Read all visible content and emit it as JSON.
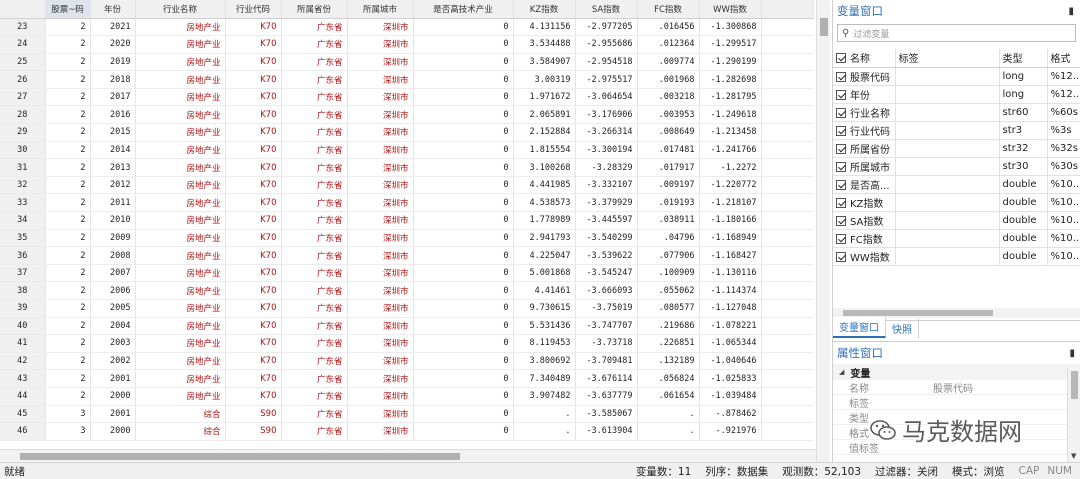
{
  "grid": {
    "columns": [
      "股票~码",
      "年份",
      "行业名称",
      "行业代码",
      "所属省份",
      "所属城市",
      "是否高技术产业",
      "KZ指数",
      "SA指数",
      "FC指数",
      "WW指数"
    ],
    "rows": [
      [
        "23",
        "2",
        "2021",
        "房地产业",
        "K70",
        "广东省",
        "深圳市",
        "0",
        "4.131156",
        "-2.977205",
        ".016456",
        "-1.300868"
      ],
      [
        "24",
        "2",
        "2020",
        "房地产业",
        "K70",
        "广东省",
        "深圳市",
        "0",
        "3.534488",
        "-2.955686",
        ".012364",
        "-1.299517"
      ],
      [
        "25",
        "2",
        "2019",
        "房地产业",
        "K70",
        "广东省",
        "深圳市",
        "0",
        "3.584907",
        "-2.954518",
        ".009774",
        "-1.290199"
      ],
      [
        "26",
        "2",
        "2018",
        "房地产业",
        "K70",
        "广东省",
        "深圳市",
        "0",
        "3.00319",
        "-2.975517",
        ".001968",
        "-1.282698"
      ],
      [
        "27",
        "2",
        "2017",
        "房地产业",
        "K70",
        "广东省",
        "深圳市",
        "0",
        "1.971672",
        "-3.064654",
        ".003218",
        "-1.281795"
      ],
      [
        "28",
        "2",
        "2016",
        "房地产业",
        "K70",
        "广东省",
        "深圳市",
        "0",
        "2.065891",
        "-3.176906",
        ".003953",
        "-1.249618"
      ],
      [
        "29",
        "2",
        "2015",
        "房地产业",
        "K70",
        "广东省",
        "深圳市",
        "0",
        "2.152884",
        "-3.266314",
        ".008649",
        "-1.213458"
      ],
      [
        "30",
        "2",
        "2014",
        "房地产业",
        "K70",
        "广东省",
        "深圳市",
        "0",
        "1.815554",
        "-3.300194",
        ".017481",
        "-1.241766"
      ],
      [
        "31",
        "2",
        "2013",
        "房地产业",
        "K70",
        "广东省",
        "深圳市",
        "0",
        "3.100268",
        "-3.28329",
        ".017917",
        "-1.2272"
      ],
      [
        "32",
        "2",
        "2012",
        "房地产业",
        "K70",
        "广东省",
        "深圳市",
        "0",
        "4.441985",
        "-3.332107",
        ".009197",
        "-1.220772"
      ],
      [
        "33",
        "2",
        "2011",
        "房地产业",
        "K70",
        "广东省",
        "深圳市",
        "0",
        "4.538573",
        "-3.379929",
        ".019193",
        "-1.218107"
      ],
      [
        "34",
        "2",
        "2010",
        "房地产业",
        "K70",
        "广东省",
        "深圳市",
        "0",
        "1.778989",
        "-3.445597",
        ".038911",
        "-1.180166"
      ],
      [
        "35",
        "2",
        "2009",
        "房地产业",
        "K70",
        "广东省",
        "深圳市",
        "0",
        "2.941793",
        "-3.540299",
        ".04796",
        "-1.168949"
      ],
      [
        "36",
        "2",
        "2008",
        "房地产业",
        "K70",
        "广东省",
        "深圳市",
        "0",
        "4.225047",
        "-3.539622",
        ".077906",
        "-1.168427"
      ],
      [
        "37",
        "2",
        "2007",
        "房地产业",
        "K70",
        "广东省",
        "深圳市",
        "0",
        "5.001868",
        "-3.545247",
        ".100909",
        "-1.130116"
      ],
      [
        "38",
        "2",
        "2006",
        "房地产业",
        "K70",
        "广东省",
        "深圳市",
        "0",
        "4.41461",
        "-3.666093",
        ".055062",
        "-1.114374"
      ],
      [
        "39",
        "2",
        "2005",
        "房地产业",
        "K70",
        "广东省",
        "深圳市",
        "0",
        "9.730615",
        "-3.75019",
        ".080577",
        "-1.127048"
      ],
      [
        "40",
        "2",
        "2004",
        "房地产业",
        "K70",
        "广东省",
        "深圳市",
        "0",
        "5.531436",
        "-3.747707",
        ".219686",
        "-1.078221"
      ],
      [
        "41",
        "2",
        "2003",
        "房地产业",
        "K70",
        "广东省",
        "深圳市",
        "0",
        "8.119453",
        "-3.73718",
        ".226851",
        "-1.065344"
      ],
      [
        "42",
        "2",
        "2002",
        "房地产业",
        "K70",
        "广东省",
        "深圳市",
        "0",
        "3.800692",
        "-3.709481",
        ".132189",
        "-1.040646"
      ],
      [
        "43",
        "2",
        "2001",
        "房地产业",
        "K70",
        "广东省",
        "深圳市",
        "0",
        "7.340489",
        "-3.676114",
        ".056824",
        "-1.025833"
      ],
      [
        "44",
        "2",
        "2000",
        "房地产业",
        "K70",
        "广东省",
        "深圳市",
        "0",
        "3.907482",
        "-3.637779",
        ".061654",
        "-1.039484"
      ],
      [
        "45",
        "3",
        "2001",
        "综合",
        "S90",
        "广东省",
        "深圳市",
        "0",
        ".",
        "-3.585067",
        ".",
        "-.878462"
      ],
      [
        "46",
        "3",
        "2000",
        "综合",
        "S90",
        "广东省",
        "深圳市",
        "0",
        ".",
        "-3.613904",
        ".",
        "-.921976"
      ]
    ]
  },
  "variables_panel": {
    "title": "变量窗口",
    "pin": "📌",
    "filter_placeholder": "过滤变量",
    "headers": [
      "名称",
      "标签",
      "类型",
      "格式"
    ],
    "items": [
      {
        "name": "股票代码",
        "label": "",
        "type": "long",
        "format": "%12.."
      },
      {
        "name": "年份",
        "label": "",
        "type": "long",
        "format": "%12.."
      },
      {
        "name": "行业名称",
        "label": "",
        "type": "str60",
        "format": "%60s"
      },
      {
        "name": "行业代码",
        "label": "",
        "type": "str3",
        "format": "%3s"
      },
      {
        "name": "所属省份",
        "label": "",
        "type": "str32",
        "format": "%32s"
      },
      {
        "name": "所属城市",
        "label": "",
        "type": "str30",
        "format": "%30s"
      },
      {
        "name": "是否高...",
        "label": "",
        "type": "double",
        "format": "%10.."
      },
      {
        "name": "KZ指数",
        "label": "",
        "type": "double",
        "format": "%10.."
      },
      {
        "name": "SA指数",
        "label": "",
        "type": "double",
        "format": "%10.."
      },
      {
        "name": "FC指数",
        "label": "",
        "type": "double",
        "format": "%10.."
      },
      {
        "name": "WW指数",
        "label": "",
        "type": "double",
        "format": "%10.."
      }
    ],
    "tabs": [
      "变量窗口",
      "快照"
    ]
  },
  "properties_panel": {
    "title": "属性窗口",
    "pin": "📌",
    "group": "变量",
    "rows": [
      {
        "key": "名称",
        "value": "股票代码"
      },
      {
        "key": "标签",
        "value": ""
      },
      {
        "key": "类型",
        "value": ""
      },
      {
        "key": "格式",
        "value": ""
      },
      {
        "key": "值标签",
        "value": ""
      }
    ]
  },
  "watermark": "马克数据网",
  "status": {
    "ready": "就绪",
    "var_count": "变量数：11",
    "sort": "列序：数据集",
    "obs": "观测数：52,103",
    "filter": "过滤器：关闭",
    "mode": "模式：浏览",
    "caps": "CAP",
    "num": "NUM"
  }
}
